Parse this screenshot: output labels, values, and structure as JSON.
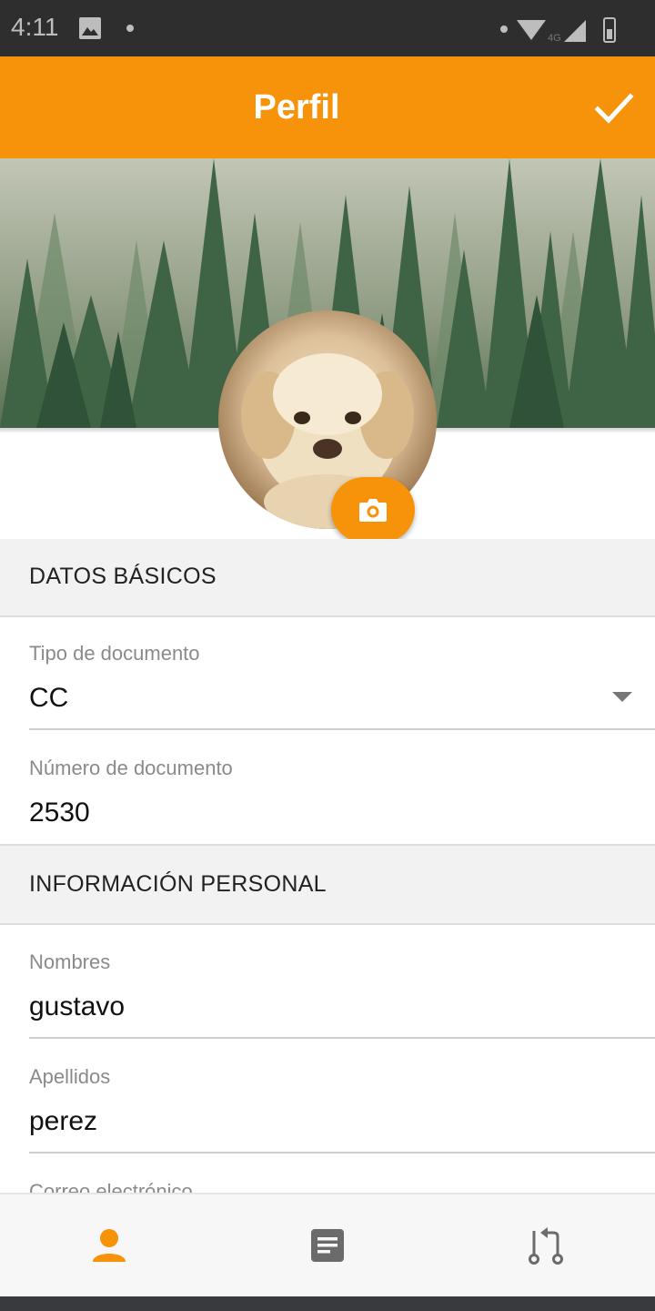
{
  "status_bar": {
    "time": "4:11"
  },
  "app_bar": {
    "title": "Perfil",
    "confirm_icon": "check-icon",
    "color": "#f7930a"
  },
  "profile": {
    "camera_icon": "camera-icon"
  },
  "sections": {
    "basic": {
      "title": "DATOS BÁSICOS",
      "document_type": {
        "label": "Tipo de documento",
        "value": "CC"
      },
      "document_number": {
        "label": "Número de documento",
        "value": "2530"
      }
    },
    "personal": {
      "title": "INFORMACIÓN PERSONAL",
      "names": {
        "label": "Nombres",
        "value": "gustavo"
      },
      "surnames": {
        "label": "Apellidos",
        "value": "perez"
      },
      "email": {
        "label": "Correo electrónico"
      }
    }
  },
  "bottom_nav": {
    "items": [
      {
        "icon": "person-icon",
        "active": true
      },
      {
        "icon": "document-icon",
        "active": false
      },
      {
        "icon": "pull-request-icon",
        "active": false
      }
    ],
    "active_color": "#f7930a",
    "inactive_color": "#6b6b6b"
  }
}
